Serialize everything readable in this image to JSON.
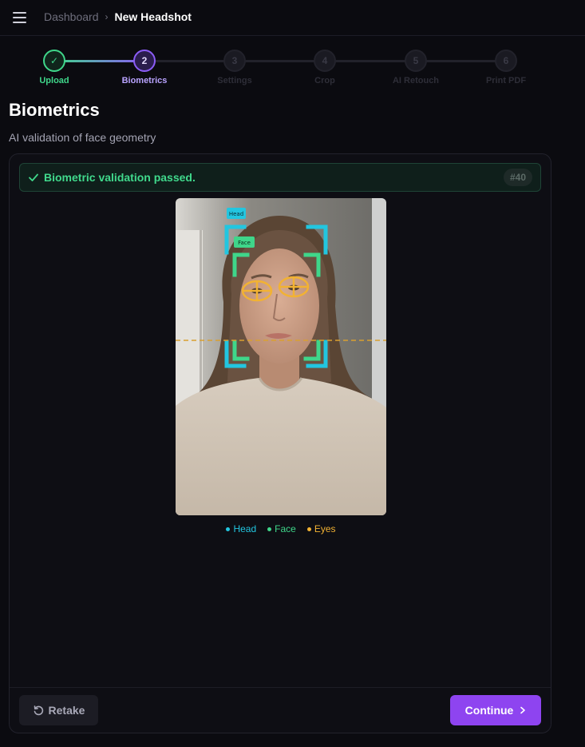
{
  "header": {
    "breadcrumb_parent": "Dashboard",
    "breadcrumb_separator": "›",
    "breadcrumb_current": "New Headshot"
  },
  "steps": [
    {
      "number": "✓",
      "label": "Upload",
      "state": "done"
    },
    {
      "number": "2",
      "label": "Biometrics",
      "state": "active"
    },
    {
      "number": "3",
      "label": "Settings",
      "state": "pending"
    },
    {
      "number": "4",
      "label": "Crop",
      "state": "pending"
    },
    {
      "number": "5",
      "label": "AI Retouch",
      "state": "pending"
    },
    {
      "number": "6",
      "label": "Print PDF",
      "state": "pending"
    }
  ],
  "page": {
    "title": "Biometrics",
    "subtitle": "AI validation of face geometry"
  },
  "validation": {
    "message": "Biometric validation passed.",
    "badge": "#40"
  },
  "overlay": {
    "head_tag": "Head",
    "face_tag": "Face"
  },
  "legend": [
    {
      "label": "Head",
      "color": "#22c6e0"
    },
    {
      "label": "Face",
      "color": "#3fd68a"
    },
    {
      "label": "Eyes",
      "color": "#f2b233"
    }
  ],
  "actions": {
    "retake_label": "Retake",
    "continue_label": "Continue"
  },
  "colors": {
    "accent": "#8e44f0",
    "success": "#40d98c",
    "head": "#22c6e0",
    "face": "#3fd68a",
    "eyes": "#f2b233"
  }
}
